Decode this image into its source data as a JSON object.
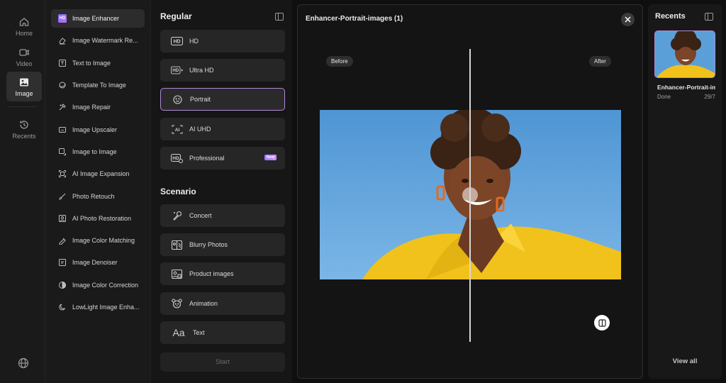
{
  "rail": {
    "items": [
      {
        "label": "Home",
        "icon": "home-icon"
      },
      {
        "label": "Video",
        "icon": "video-icon"
      },
      {
        "label": "Image",
        "icon": "image-icon",
        "active": true
      },
      {
        "label": "Recents",
        "icon": "history-icon"
      }
    ],
    "globe_icon": "globe-icon"
  },
  "tools": {
    "items": [
      {
        "label": "Image Enhancer",
        "active": true
      },
      {
        "label": "Image Watermark Re..."
      },
      {
        "label": "Text to Image"
      },
      {
        "label": "Template To Image"
      },
      {
        "label": "Image Repair"
      },
      {
        "label": "Image Upscaler"
      },
      {
        "label": "Image to Image"
      },
      {
        "label": "AI Image Expansion"
      },
      {
        "label": "Photo Retouch"
      },
      {
        "label": "AI Photo Restoration"
      },
      {
        "label": "Image Color Matching"
      },
      {
        "label": "Image Denoiser"
      },
      {
        "label": "Image Color Correction"
      },
      {
        "label": "LowLight Image Enha..."
      }
    ]
  },
  "options": {
    "regular_title": "Regular",
    "regular": [
      {
        "label": "HD"
      },
      {
        "label": "Ultra HD"
      },
      {
        "label": "Portrait",
        "active": true
      },
      {
        "label": "AI UHD"
      },
      {
        "label": "Professional",
        "badge": "New"
      }
    ],
    "scenario_title": "Scenario",
    "scenario": [
      {
        "label": "Concert"
      },
      {
        "label": "Blurry Photos"
      },
      {
        "label": "Product images"
      },
      {
        "label": "Animation"
      },
      {
        "label": "Text"
      }
    ],
    "start_label": "Start"
  },
  "preview": {
    "title": "Enhancer-Portrait-images (1)",
    "before_label": "Before",
    "after_label": "After"
  },
  "recents": {
    "title": "Recents",
    "item": {
      "name": "Enhancer-Portrait-images",
      "status": "Done",
      "date": "29/7"
    },
    "view_all": "View all"
  },
  "colors": {
    "accent": "#b08ad8",
    "sky": "#5b9fd8",
    "shirt": "#f1c21b"
  }
}
